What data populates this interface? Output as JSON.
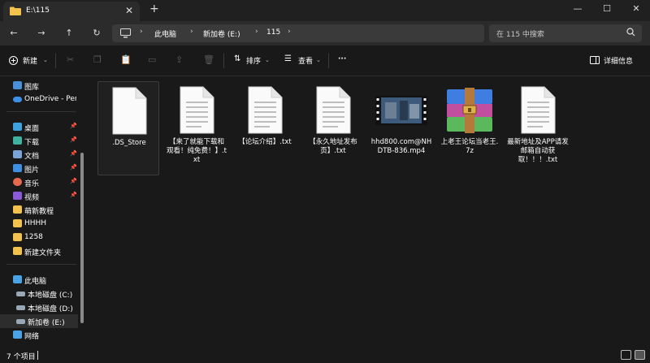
{
  "window": {
    "tab_title": "E:\\115",
    "tab_close": "✕",
    "new_tab": "+",
    "minimize": "—",
    "maximize": "☐",
    "close": "✕"
  },
  "nav": {
    "back": "←",
    "forward": "→",
    "up": "↑",
    "refresh": "↻",
    "breadcrumbs": [
      "此电脑",
      "新加卷 (E:)",
      "115"
    ],
    "crumb_sep": "›",
    "search_placeholder": "在 115 中搜索",
    "search_icon": "🔍"
  },
  "toolbar": {
    "new_label": "新建",
    "sort_label": "排序",
    "view_label": "查看",
    "more_label": "···",
    "details_label": "详细信息"
  },
  "sidebar": {
    "items": [
      {
        "label": "图库",
        "icon": "gallery-icon",
        "color": "#4a90d9"
      },
      {
        "label": "OneDrive - Perso",
        "icon": "cloud-icon",
        "color": "#3d8ee6"
      },
      {
        "label": "桌面",
        "icon": "desktop-icon",
        "color": "#3fa3e0"
      },
      {
        "label": "下载",
        "icon": "download-icon",
        "color": "#3fb2a0"
      },
      {
        "label": "文档",
        "icon": "document-icon",
        "color": "#7aa5d6"
      },
      {
        "label": "图片",
        "icon": "picture-icon",
        "color": "#3f8fe0"
      },
      {
        "label": "音乐",
        "icon": "music-icon",
        "color": "#e66a50"
      },
      {
        "label": "视频",
        "icon": "video-icon",
        "color": "#8b5ad6"
      },
      {
        "label": "萌新教程",
        "icon": "folder-icon",
        "color": "#f2c14e"
      },
      {
        "label": "HHHH",
        "icon": "folder-icon",
        "color": "#f2c14e"
      },
      {
        "label": "1258",
        "icon": "folder-icon",
        "color": "#f2c14e"
      },
      {
        "label": "新建文件夹",
        "icon": "folder-icon",
        "color": "#f2c14e"
      },
      {
        "label": "此电脑",
        "icon": "pc-icon",
        "color": "#4aa3e6"
      },
      {
        "label": "本地磁盘 (C:)",
        "icon": "drive-icon",
        "color": "#9aa8b6"
      },
      {
        "label": "本地磁盘 (D:)",
        "icon": "drive-icon",
        "color": "#9aa8b6"
      },
      {
        "label": "新加卷 (E:)",
        "icon": "drive-icon",
        "color": "#9aa8b6"
      },
      {
        "label": "网络",
        "icon": "network-icon",
        "color": "#4aa3e6"
      }
    ],
    "pin": "📌"
  },
  "files": [
    {
      "name": ".DS_Store",
      "type": "blank"
    },
    {
      "name": "【来了就能下载和观看！纯免费！】.txt",
      "type": "txt"
    },
    {
      "name": "【论坛介绍】.txt",
      "type": "txt"
    },
    {
      "name": "【永久地址发布页】.txt",
      "type": "txt"
    },
    {
      "name": "hhd800.com@NHDTB-836.mp4",
      "type": "video"
    },
    {
      "name": "上老王论坛当老王.7z",
      "type": "archive"
    },
    {
      "name": "最新地址及APP请发邮箱自动获取！！！.txt",
      "type": "txt"
    }
  ],
  "status": {
    "count": "7 个项目"
  }
}
